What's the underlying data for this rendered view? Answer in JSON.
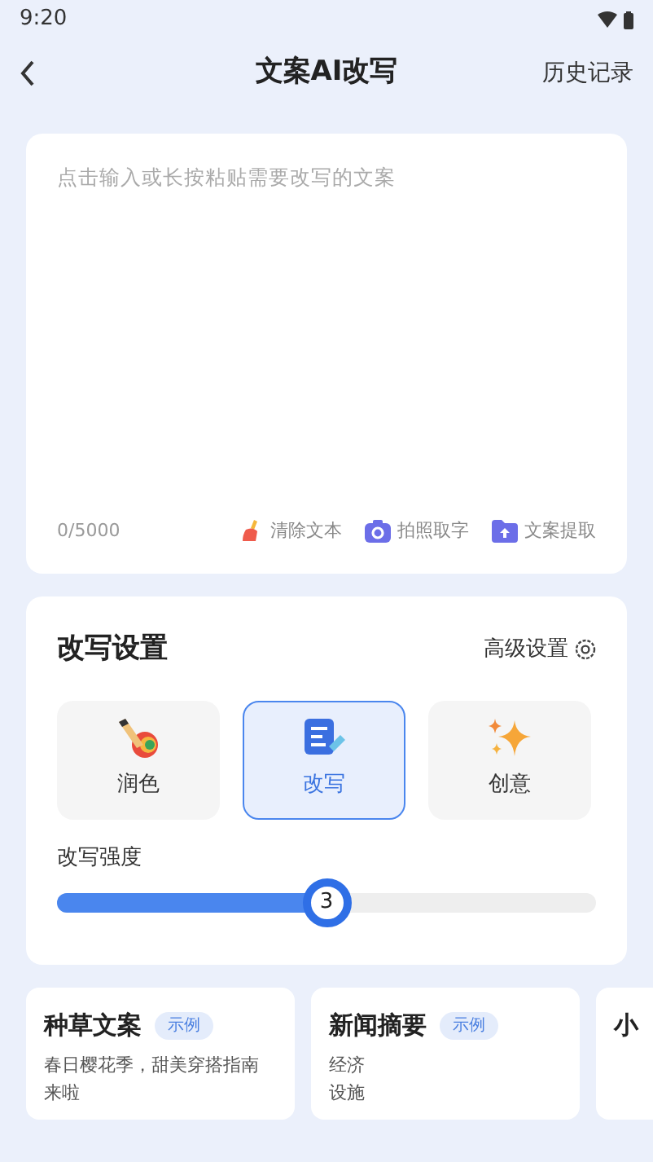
{
  "status_bar": {
    "time": "9:20"
  },
  "header": {
    "title": "文案AI改写",
    "action": "历史记录"
  },
  "input": {
    "placeholder": "点击输入或长按粘贴需要改写的文案",
    "count": "0/5000",
    "tools": [
      {
        "kind": "broom",
        "label": "清除文本"
      },
      {
        "kind": "camera",
        "label": "拍照取字"
      },
      {
        "kind": "upload",
        "label": "文案提取"
      }
    ]
  },
  "settings": {
    "title": "改写设置",
    "advanced": "高级设置",
    "modes": [
      {
        "kind": "brush",
        "label": "润色",
        "selected": false
      },
      {
        "kind": "doc",
        "label": "改写",
        "selected": true
      },
      {
        "kind": "sparkle",
        "label": "创意",
        "selected": false
      }
    ],
    "strength": {
      "label": "改写强度",
      "level": 0.5,
      "value": "3"
    }
  },
  "examples": [
    {
      "title": "种草文案",
      "tag": "示例",
      "lines": [
        "春日樱花季，甜美穿搭指南",
        "来啦"
      ]
    },
    {
      "title": "新闻摘要",
      "tag": "示例",
      "lines": [
        "经济",
        "设施"
      ]
    },
    {
      "title": "小"
    }
  ]
}
